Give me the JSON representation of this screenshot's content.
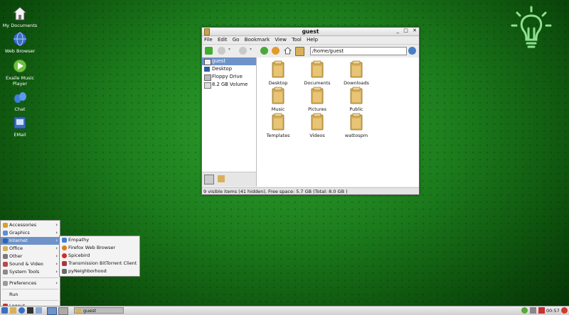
{
  "desktop": {
    "icons": [
      {
        "label": "My Documents",
        "icon": "home-icon"
      },
      {
        "label": "Web Browser",
        "icon": "globe-icon"
      },
      {
        "label": "Exaile Music Player",
        "icon": "play-icon"
      },
      {
        "label": "Chat",
        "icon": "chat-icon"
      },
      {
        "label": "EMail",
        "icon": "mail-icon"
      }
    ]
  },
  "window": {
    "title": "guest",
    "menu": [
      "File",
      "Edit",
      "Go",
      "Bookmark",
      "View",
      "Tool",
      "Help"
    ],
    "address": "/home/guest",
    "sidebar": [
      "guest",
      "Desktop",
      "Floppy Drive",
      "8.2 GB Volume"
    ],
    "folders": [
      "Desktop",
      "Documents",
      "Downloads",
      "Music",
      "Pictures",
      "Public",
      "Templates",
      "Videos",
      "wattospm"
    ],
    "status": "9 visible items (41 hidden), Free space: 5.7 GB (Total: 8.0 GB )"
  },
  "startmenu": {
    "items": [
      "Accessories",
      "Graphics",
      "Internet",
      "Office",
      "Other",
      "Sound & Video",
      "System Tools"
    ],
    "preferences": "Preferences",
    "run": "Run",
    "logout": "Logout"
  },
  "submenu": {
    "items": [
      "Empathy",
      "Firefox Web Browser",
      "Spicebird",
      "Transmission BitTorrent Client",
      "pyNeighborhood"
    ]
  },
  "taskbar": {
    "task": "guest",
    "clock": "00:57"
  },
  "colors": {
    "selection": "#6f93c9",
    "folder": "#d9b05a"
  }
}
